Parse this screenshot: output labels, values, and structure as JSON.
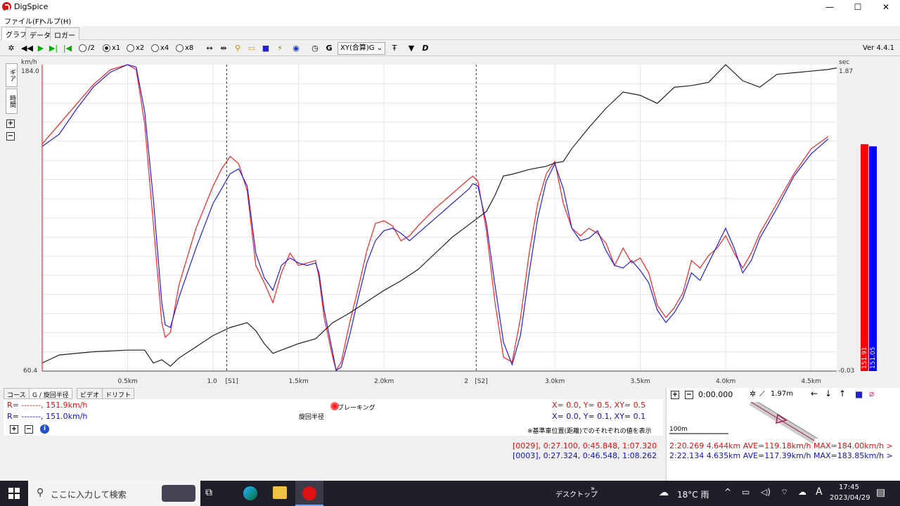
{
  "window": {
    "title": "DigSpice",
    "minimize": "—",
    "maximize": "☐",
    "close": "✕"
  },
  "menu": [
    "ファイル(F)",
    "ヘルプ(H)"
  ],
  "tabs": [
    "グラフ",
    "データ",
    "ロガー"
  ],
  "toolbar": {
    "speed_options": [
      "/2",
      "x1",
      "x2",
      "x4",
      "x8"
    ],
    "selected_speed": "x1",
    "mode_select": "XY(合算)G",
    "version": "Ver 4.4.1"
  },
  "side_tabs": [
    "ギア",
    "時間"
  ],
  "chart_data": {
    "type": "line",
    "left_axis": {
      "unit": "km/h",
      "top_label": "184.0",
      "bottom_label": "60.4",
      "ylim": [
        60.4,
        184.0
      ]
    },
    "right_axis": {
      "unit": "sec",
      "top_label": "1.87",
      "bottom_label": "-0.03",
      "ylim": [
        -0.03,
        1.87
      ]
    },
    "xlim": [
      0.0,
      4.65
    ],
    "x_ticks": [
      {
        "x": 0.5,
        "label": "0.5km"
      },
      {
        "x": 1.0,
        "label": "1.0"
      },
      {
        "x": 1.5,
        "label": "1.5km"
      },
      {
        "x": 2.0,
        "label": "2.0km"
      },
      {
        "x": 2.0,
        "label": "2"
      },
      {
        "x": 3.0,
        "label": "3.0km"
      },
      {
        "x": 3.5,
        "label": "3.5km"
      },
      {
        "x": 4.0,
        "label": "4.0km"
      },
      {
        "x": 4.5,
        "label": "4.5km"
      }
    ],
    "sectors": [
      {
        "x": 1.08,
        "label": "[S1]"
      },
      {
        "x": 2.54,
        "label": "[S2]"
      }
    ],
    "series": [
      {
        "color": "#ff2020",
        "axis": "left",
        "points": [
          [
            0,
            152
          ],
          [
            0.1,
            160
          ],
          [
            0.2,
            168
          ],
          [
            0.3,
            176
          ],
          [
            0.4,
            182
          ],
          [
            0.5,
            184
          ],
          [
            0.55,
            182
          ],
          [
            0.6,
            160
          ],
          [
            0.65,
            120
          ],
          [
            0.7,
            80
          ],
          [
            0.72,
            74
          ],
          [
            0.75,
            76
          ],
          [
            0.8,
            95
          ],
          [
            0.9,
            118
          ],
          [
            1.0,
            135
          ],
          [
            1.05,
            142
          ],
          [
            1.1,
            147
          ],
          [
            1.15,
            144
          ],
          [
            1.2,
            133
          ],
          [
            1.25,
            103
          ],
          [
            1.3,
            96
          ],
          [
            1.35,
            88
          ],
          [
            1.4,
            100
          ],
          [
            1.45,
            108
          ],
          [
            1.5,
            103
          ],
          [
            1.55,
            104
          ],
          [
            1.6,
            105
          ],
          [
            1.62,
            98
          ],
          [
            1.65,
            82
          ],
          [
            1.7,
            66
          ],
          [
            1.72,
            60.8
          ],
          [
            1.75,
            64
          ],
          [
            1.8,
            80
          ],
          [
            1.85,
            94
          ],
          [
            1.9,
            109
          ],
          [
            1.95,
            120
          ],
          [
            2.0,
            121
          ],
          [
            2.05,
            119
          ],
          [
            2.1,
            113
          ],
          [
            2.15,
            115
          ],
          [
            2.2,
            119
          ],
          [
            2.3,
            126
          ],
          [
            2.4,
            132
          ],
          [
            2.5,
            138
          ],
          [
            2.52,
            139
          ],
          [
            2.55,
            137
          ],
          [
            2.6,
            117
          ],
          [
            2.65,
            88
          ],
          [
            2.7,
            66
          ],
          [
            2.75,
            64
          ],
          [
            2.8,
            82
          ],
          [
            2.85,
            108
          ],
          [
            2.9,
            128
          ],
          [
            2.95,
            140
          ],
          [
            3.0,
            145
          ],
          [
            3.05,
            128
          ],
          [
            3.1,
            118
          ],
          [
            3.15,
            115
          ],
          [
            3.2,
            118
          ],
          [
            3.25,
            116
          ],
          [
            3.3,
            112
          ],
          [
            3.35,
            103
          ],
          [
            3.4,
            110
          ],
          [
            3.45,
            104
          ],
          [
            3.5,
            106
          ],
          [
            3.55,
            100
          ],
          [
            3.6,
            87
          ],
          [
            3.65,
            82
          ],
          [
            3.7,
            86
          ],
          [
            3.75,
            92
          ],
          [
            3.8,
            105
          ],
          [
            3.85,
            102
          ],
          [
            3.9,
            107
          ],
          [
            3.95,
            110
          ],
          [
            4.0,
            115
          ],
          [
            4.05,
            108
          ],
          [
            4.1,
            102
          ],
          [
            4.15,
            108
          ],
          [
            4.2,
            116
          ],
          [
            4.3,
            128
          ],
          [
            4.4,
            140
          ],
          [
            4.5,
            150
          ],
          [
            4.6,
            155
          ]
        ]
      },
      {
        "color": "#2020ee",
        "axis": "left",
        "points": [
          [
            0,
            151
          ],
          [
            0.1,
            156
          ],
          [
            0.2,
            166
          ],
          [
            0.3,
            175
          ],
          [
            0.4,
            181
          ],
          [
            0.5,
            184
          ],
          [
            0.55,
            183
          ],
          [
            0.6,
            165
          ],
          [
            0.65,
            130
          ],
          [
            0.7,
            88
          ],
          [
            0.72,
            79
          ],
          [
            0.75,
            78
          ],
          [
            0.8,
            90
          ],
          [
            0.9,
            110
          ],
          [
            1.0,
            128
          ],
          [
            1.05,
            134
          ],
          [
            1.1,
            140
          ],
          [
            1.15,
            142
          ],
          [
            1.2,
            135
          ],
          [
            1.25,
            108
          ],
          [
            1.3,
            98
          ],
          [
            1.35,
            93
          ],
          [
            1.4,
            103
          ],
          [
            1.45,
            106
          ],
          [
            1.5,
            104
          ],
          [
            1.55,
            103
          ],
          [
            1.6,
            104
          ],
          [
            1.62,
            100
          ],
          [
            1.65,
            85
          ],
          [
            1.7,
            68
          ],
          [
            1.72,
            60.6
          ],
          [
            1.75,
            62
          ],
          [
            1.8,
            75
          ],
          [
            1.85,
            90
          ],
          [
            1.9,
            104
          ],
          [
            1.95,
            113
          ],
          [
            2.0,
            117
          ],
          [
            2.05,
            118
          ],
          [
            2.1,
            116
          ],
          [
            2.15,
            113
          ],
          [
            2.2,
            116
          ],
          [
            2.3,
            122
          ],
          [
            2.4,
            128
          ],
          [
            2.5,
            134
          ],
          [
            2.52,
            136
          ],
          [
            2.55,
            135
          ],
          [
            2.6,
            120
          ],
          [
            2.65,
            95
          ],
          [
            2.7,
            72
          ],
          [
            2.75,
            63
          ],
          [
            2.8,
            75
          ],
          [
            2.85,
            100
          ],
          [
            2.9,
            122
          ],
          [
            2.95,
            137
          ],
          [
            3.0,
            144
          ],
          [
            3.05,
            134
          ],
          [
            3.1,
            118
          ],
          [
            3.15,
            113
          ],
          [
            3.2,
            114
          ],
          [
            3.25,
            117
          ],
          [
            3.3,
            109
          ],
          [
            3.35,
            103
          ],
          [
            3.4,
            102
          ],
          [
            3.45,
            105
          ],
          [
            3.5,
            101
          ],
          [
            3.55,
            96
          ],
          [
            3.6,
            85
          ],
          [
            3.65,
            80
          ],
          [
            3.7,
            84
          ],
          [
            3.75,
            90
          ],
          [
            3.8,
            100
          ],
          [
            3.85,
            97
          ],
          [
            3.9,
            104
          ],
          [
            3.95,
            111
          ],
          [
            4.0,
            118
          ],
          [
            4.05,
            110
          ],
          [
            4.1,
            100
          ],
          [
            4.15,
            105
          ],
          [
            4.2,
            114
          ],
          [
            4.3,
            126
          ],
          [
            4.4,
            139
          ],
          [
            4.5,
            148
          ],
          [
            4.6,
            154
          ]
        ]
      },
      {
        "color": "#202020",
        "axis": "right",
        "points": [
          [
            0,
            0.02
          ],
          [
            0.1,
            0.07
          ],
          [
            0.3,
            0.09
          ],
          [
            0.5,
            0.1
          ],
          [
            0.6,
            0.1
          ],
          [
            0.65,
            0.02
          ],
          [
            0.7,
            0.04
          ],
          [
            0.75,
            0.0
          ],
          [
            0.8,
            0.05
          ],
          [
            0.9,
            0.12
          ],
          [
            1.0,
            0.19
          ],
          [
            1.1,
            0.24
          ],
          [
            1.2,
            0.27
          ],
          [
            1.25,
            0.22
          ],
          [
            1.3,
            0.14
          ],
          [
            1.35,
            0.08
          ],
          [
            1.4,
            0.1
          ],
          [
            1.5,
            0.14
          ],
          [
            1.6,
            0.17
          ],
          [
            1.7,
            0.27
          ],
          [
            1.8,
            0.33
          ],
          [
            1.9,
            0.4
          ],
          [
            2.0,
            0.47
          ],
          [
            2.1,
            0.53
          ],
          [
            2.2,
            0.6
          ],
          [
            2.3,
            0.7
          ],
          [
            2.4,
            0.8
          ],
          [
            2.5,
            0.88
          ],
          [
            2.6,
            0.96
          ],
          [
            2.65,
            1.06
          ],
          [
            2.7,
            1.18
          ],
          [
            2.75,
            1.19
          ],
          [
            2.85,
            1.22
          ],
          [
            2.95,
            1.24
          ],
          [
            3.0,
            1.26
          ],
          [
            3.05,
            1.27
          ],
          [
            3.1,
            1.35
          ],
          [
            3.2,
            1.48
          ],
          [
            3.3,
            1.6
          ],
          [
            3.4,
            1.7
          ],
          [
            3.5,
            1.68
          ],
          [
            3.6,
            1.63
          ],
          [
            3.7,
            1.73
          ],
          [
            3.8,
            1.74
          ],
          [
            3.9,
            1.76
          ],
          [
            4.0,
            1.87
          ],
          [
            4.1,
            1.77
          ],
          [
            4.2,
            1.73
          ],
          [
            4.3,
            1.81
          ],
          [
            4.4,
            1.82
          ],
          [
            4.5,
            1.83
          ],
          [
            4.6,
            1.84
          ],
          [
            4.65,
            1.85
          ]
        ]
      }
    ]
  },
  "value_bars": [
    {
      "label": "151.91",
      "color": "#ff0000",
      "value": 151.91
    },
    {
      "label": "151.05",
      "color": "#0000ff",
      "value": 151.05
    }
  ],
  "bottom_tabs": [
    "コース",
    "G / 旋回半径",
    "ビデオ",
    "ドリフト"
  ],
  "info": {
    "red_line": "R= -------, 151.9km/h",
    "blue_line": "R= -------, 151.0km/h",
    "red_xy": "X=  0.0, Y=  0.5, XY= 0.5",
    "blue_xy": "X=  0.0, Y=  0.1, XY= 0.1",
    "center_label": "ブレーキング",
    "center_label2": "旋回半径",
    "note": "※基準車位置(距離)でのそれぞれの値を表示",
    "red_timing": "[0029], 0:27.100, 0:45.848, 1:07.320",
    "blue_timing": "[0003], 0:27.324, 0:46.548, 1:08.262"
  },
  "right_panel": {
    "time": "0:00.000",
    "distance": "1.97m",
    "scale": "100m",
    "red_lap": "2:20.269 4.644km AVE=119.18km/h MAX=184.00km/h >",
    "blue_lap": "2:22.134 4.635km AVE=117.39km/h MAX=183.85km/h >"
  },
  "taskbar": {
    "search_placeholder": "ここに入力して検索",
    "desktop": "デスクトップ",
    "weather": "18°C 雨",
    "ime": "A",
    "time": "17:45",
    "date": "2023/04/29"
  }
}
